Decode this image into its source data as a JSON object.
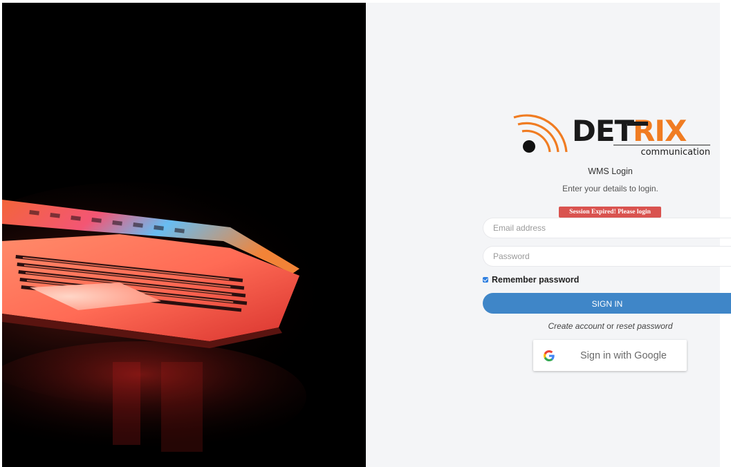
{
  "brand": {
    "logo_main": "DETRIX",
    "logo_sub": "communication",
    "accent_color": "#f07c22",
    "dark_color": "#1a1a1a"
  },
  "login": {
    "title": "WMS Login",
    "subtitle": "Enter your details to login.",
    "alert": "Session Expired! Please login",
    "email_placeholder": "Email address",
    "password_placeholder": "Password",
    "remember_label": "Remember password",
    "remember_checked": true,
    "signin_label": "SIGN IN",
    "create_account_link": "Create account",
    "or_text": "or",
    "reset_password_link": "reset password",
    "google_label": "Sign in with Google",
    "google_icon": "google-g-icon"
  },
  "hero": {
    "image_icon": "laptop-image"
  },
  "colors": {
    "signin_button": "#3f86c8",
    "alert_bg": "#d9534f",
    "panel_bg": "#f4f5f7"
  }
}
